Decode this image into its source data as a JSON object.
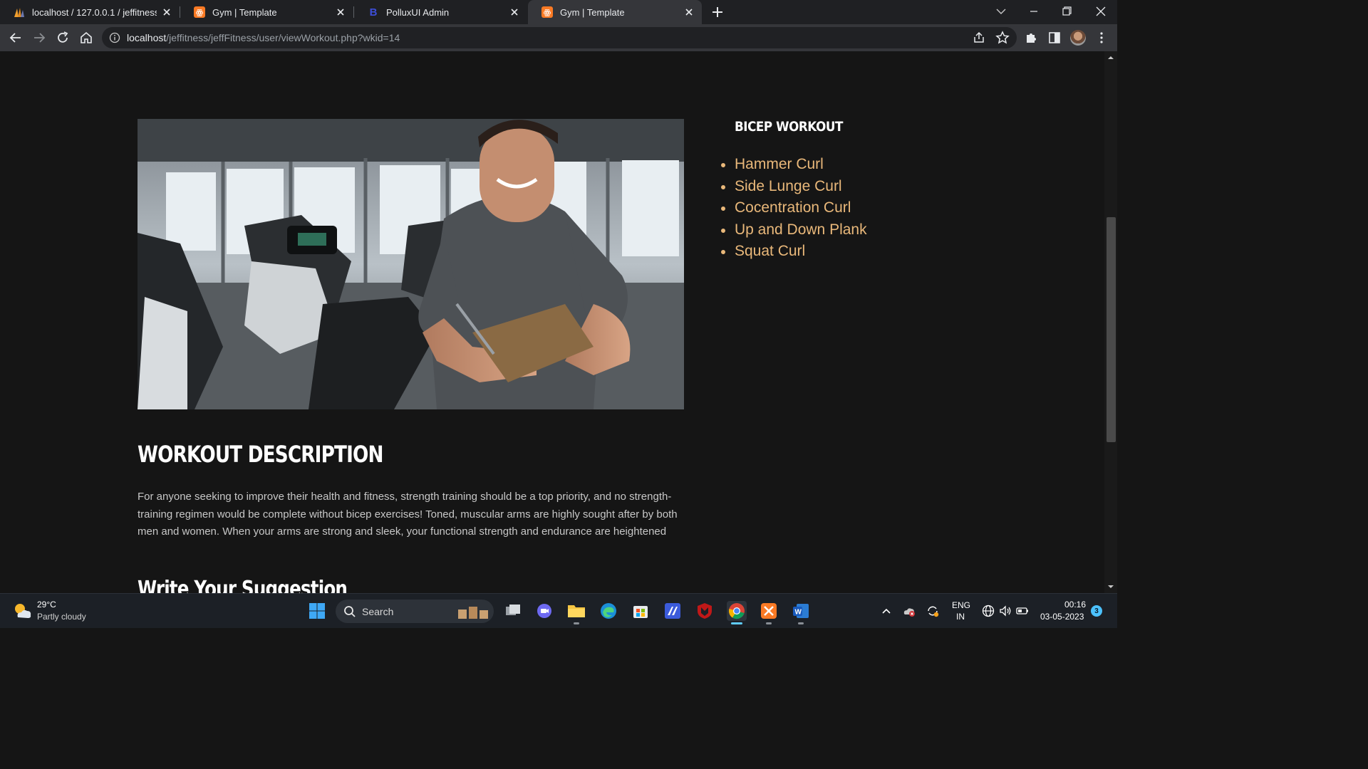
{
  "browser": {
    "tabs": [
      {
        "title": "localhost / 127.0.0.1 / jeffitness",
        "icon": "phpmyadmin-icon",
        "active": false
      },
      {
        "title": "Gym | Template",
        "icon": "xampp-icon",
        "active": false
      },
      {
        "title": "PolluxUI Admin",
        "icon": "bootstrap-icon",
        "active": false
      },
      {
        "title": "Gym | Template",
        "icon": "xampp-icon",
        "active": true
      }
    ],
    "url_host": "localhost",
    "url_path": "/jeffitness/jeffFitness/user/viewWorkout.php?wkid=14"
  },
  "page": {
    "workout_title": "BICEP WORKOUT",
    "exercises": [
      "Hammer Curl",
      "Side Lunge Curl",
      "Cocentration Curl",
      "Up and Down Plank",
      "Squat Curl"
    ],
    "description_title": "WORKOUT DESCRIPTION",
    "description_text": "For anyone seeking to improve their health and fitness, strength training should be a top priority, and no strength-training regimen would be complete without bicep exercises! Toned, muscular arms are highly sought after by both men and women. When your arms are strong and sleek, your functional strength and endurance are heightened",
    "suggestion_title": "Write Your Suggestion"
  },
  "colors": {
    "accent": "#e9b87a",
    "background": "#151515",
    "heading": "#ffffff"
  },
  "taskbar": {
    "temperature": "29°C",
    "weather": "Partly cloudy",
    "search_placeholder": "Search",
    "language": "ENG",
    "region": "IN",
    "time": "00:16",
    "date": "03-05-2023",
    "notification_count": "3"
  }
}
